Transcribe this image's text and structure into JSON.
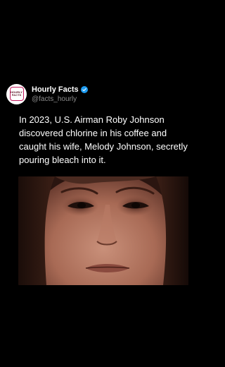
{
  "account": {
    "display_name": "Hourly Facts",
    "handle": "@facts_hourly",
    "avatar_text_top": "HOURLY",
    "avatar_text_bottom": "FACTS",
    "verified_color": "#1d9bf0"
  },
  "post": {
    "text": "In 2023, U.S. Airman Roby Johnson discovered chlorine in his coffee and caught his wife, Melody Johnson, secretly pouring bleach into it.",
    "image_subject": "close-up-face-photo"
  },
  "colors": {
    "background": "#000000",
    "text": "#ffffff",
    "secondary_text": "#8b8b8b"
  }
}
